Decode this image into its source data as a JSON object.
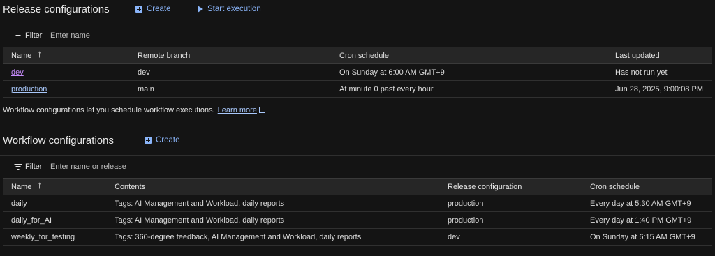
{
  "release": {
    "title": "Release configurations",
    "create_label": "Create",
    "start_label": "Start execution",
    "filter_label": "Filter",
    "filter_placeholder": "Enter name",
    "columns": [
      "Name",
      "Remote branch",
      "Cron schedule",
      "Last updated"
    ],
    "rows": [
      {
        "name": "dev",
        "branch": "dev",
        "cron": "On Sunday at 6:00 AM GMT+9",
        "updated": "Has not run yet"
      },
      {
        "name": "production",
        "branch": "main",
        "cron": "At minute 0 past every hour",
        "updated": "Jun 28, 2025, 9:00:08 PM"
      }
    ]
  },
  "info": {
    "text": "Workflow configurations let you schedule workflow executions.",
    "learn_more": "Learn more"
  },
  "workflow": {
    "title": "Workflow configurations",
    "create_label": "Create",
    "filter_label": "Filter",
    "filter_placeholder": "Enter name or release",
    "columns": [
      "Name",
      "Contents",
      "Release configuration",
      "Cron schedule"
    ],
    "rows": [
      {
        "name": "daily",
        "contents": "Tags: AI Management and Workload, daily reports",
        "release": "production",
        "cron": "Every day at 5:30 AM GMT+9"
      },
      {
        "name": "daily_for_AI",
        "contents": "Tags: AI Management and Workload, daily reports",
        "release": "production",
        "cron": "Every day at 1:40 PM GMT+9"
      },
      {
        "name": "weekly_for_testing",
        "contents": "Tags: 360-degree feedback, AI Management and Workload, daily reports",
        "release": "dev",
        "cron": "On Sunday at 6:15 AM GMT+9"
      }
    ]
  }
}
